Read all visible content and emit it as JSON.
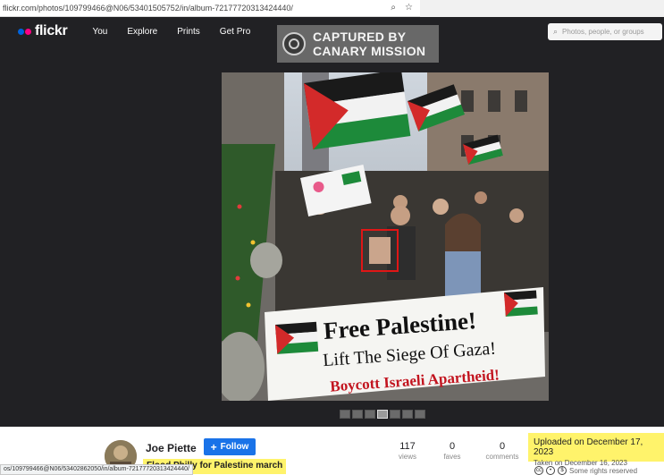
{
  "browser": {
    "url": "flickr.com/photos/109799466@N06/53401505752/in/album-72177720313424440/",
    "status_url": "os/109799466@N06/53402862050/in/album-72177720313424440/"
  },
  "header": {
    "logo": "flickr",
    "nav": [
      "You",
      "Explore",
      "Prints",
      "Get Pro"
    ],
    "search_placeholder": "Photos, people, or groups"
  },
  "watermark": {
    "line1": "CAPTURED BY",
    "line2": "CANARY MISSION"
  },
  "photo": {
    "banner_line1": "Free Palestine!",
    "banner_line2": "Lift The Siege Of Gaza!",
    "banner_line3": "Boycott Israeli Apartheid!"
  },
  "thumbnails": {
    "count": 7,
    "active_index": 3
  },
  "owner": {
    "name": "Joe Piette",
    "follow_label": "Follow"
  },
  "photo_title": "Flood Philly for Palestine march",
  "stats": [
    {
      "value": "117",
      "label": "views"
    },
    {
      "value": "0",
      "label": "faves"
    },
    {
      "value": "0",
      "label": "comments"
    }
  ],
  "dates": {
    "uploaded": "Uploaded on December 17, 2023",
    "taken": "Taken on December 16, 2023"
  },
  "license": {
    "text": "Some rights reserved"
  },
  "colors": {
    "header_bg": "#212124",
    "flickr_blue": "#0063dc",
    "flickr_pink": "#ff0084",
    "follow_blue": "#1a73e8",
    "highlight": "#fff36b"
  }
}
